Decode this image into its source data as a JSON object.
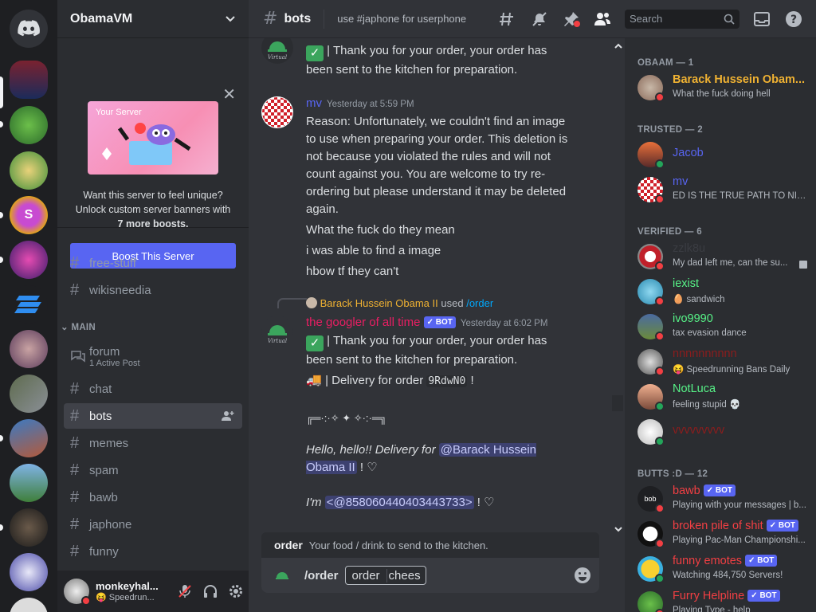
{
  "server": {
    "name": "ObamaVM"
  },
  "boost": {
    "banner_label": "Your Server",
    "line1": "Want this server to feel unique?",
    "line2": "Unlock custom server banners with",
    "line3": "7 more boosts.",
    "button": "Boost This Server"
  },
  "channels": {
    "top": [
      {
        "name": "free-stuff"
      },
      {
        "name": "wikisneedia"
      }
    ],
    "category": "MAIN",
    "forum": {
      "name": "forum",
      "sub": "1 Active Post"
    },
    "list": [
      {
        "name": "chat"
      },
      {
        "name": "bots"
      },
      {
        "name": "memes"
      },
      {
        "name": "spam"
      },
      {
        "name": "bawb"
      },
      {
        "name": "japhone"
      },
      {
        "name": "funny"
      }
    ]
  },
  "user": {
    "name": "monkeyhal...",
    "status": "Speedrun..."
  },
  "header": {
    "channel": "bots",
    "topic": "use #japhone for userphone",
    "search_placeholder": "Search"
  },
  "messages": {
    "m0": {
      "line1": "| Thank you for your order, your order has",
      "line2": "been sent to the kitchen for preparation."
    },
    "m1": {
      "author": "mv",
      "time": "Yesterday at 5:59 PM",
      "text": "Reason: Unfortunately, we couldn't find an image to use when preparing your order. This deletion is not because you violated the rules and will not count against you. You are welcome to try re-ordering but please understand it may be deleted again.",
      "f1": "What the fuck do they mean",
      "f2": "i was able to find a image",
      "f3": "hbow tf they can't"
    },
    "m2": {
      "reply_user": "Barack Hussein Obama II",
      "reply_used": "used",
      "reply_cmd": "/order",
      "author": "the googler of all time",
      "bot": "BOT",
      "time": "Yesterday at 6:02 PM",
      "line1": "| Thank you for your order, your order has",
      "line2": "been sent to the kitchen for preparation.",
      "delivery": "| Delivery for order",
      "code": "9RdwN0",
      "bang": "!",
      "deco": "╔═·:·✧ ✦ ✧·:·═╗",
      "hello": "Hello, hello!! Delivery for",
      "mention": "@Barack Hussein Obama II",
      "heart": "! ♡",
      "im": "I'm",
      "id_mention": "<@858060440403443733>",
      "heart2": "! ♡"
    }
  },
  "composer": {
    "cmd_name": "order",
    "cmd_desc": "Your food / drink to send to the kitchen.",
    "cmd": "/order",
    "option": "order",
    "value": "chees"
  },
  "members": {
    "cat_obaam": "OBAAM — 1",
    "cat_trusted": "TRUSTED — 2",
    "cat_verified": "VERIFIED — 6",
    "cat_butts": "BUTTS :D — 12",
    "obaam": [
      {
        "name": "Barack Hussein Obam...",
        "status": "What the fuck doing hell",
        "color": "#f0b232"
      }
    ],
    "trusted": [
      {
        "name": "Jacob",
        "status": "",
        "color": "#5865f2"
      },
      {
        "name": "mv",
        "status": "ED IS THE TRUE PATH TO NIR...",
        "color": "#5865f2"
      }
    ],
    "verified": [
      {
        "name": "zzlk8u",
        "status": "My dad left me, can the su...",
        "color": "#3a3c42"
      },
      {
        "name": "iexist",
        "status": "sandwich",
        "color": "#57f287"
      },
      {
        "name": "ivo9990",
        "status": "tax evasion dance",
        "color": "#57f287"
      },
      {
        "name": "nnnnnnnnnn",
        "status": "Speedrunning Bans Daily",
        "color": "#8b1d1d"
      },
      {
        "name": "NotLuca",
        "status": "feeling stupid",
        "color": "#57f287"
      },
      {
        "name": "vvvvvvvvv",
        "status": "",
        "color": "#8b1d1d"
      }
    ],
    "butts": [
      {
        "name": "bawb",
        "status": "Playing with your messages | b...",
        "bot": "BOT",
        "color": "#f23f43"
      },
      {
        "name": "broken pile of shit",
        "status": "Playing Pac-Man Championshi...",
        "bot": "BOT",
        "color": "#f23f43"
      },
      {
        "name": "funny emotes",
        "status": "Watching 484,750 Servers!",
        "bot": "BOT",
        "color": "#f23f43"
      },
      {
        "name": "Furry Helpline",
        "status": "Playing Type - help",
        "bot": "BOT",
        "color": "#f23f43"
      }
    ]
  }
}
